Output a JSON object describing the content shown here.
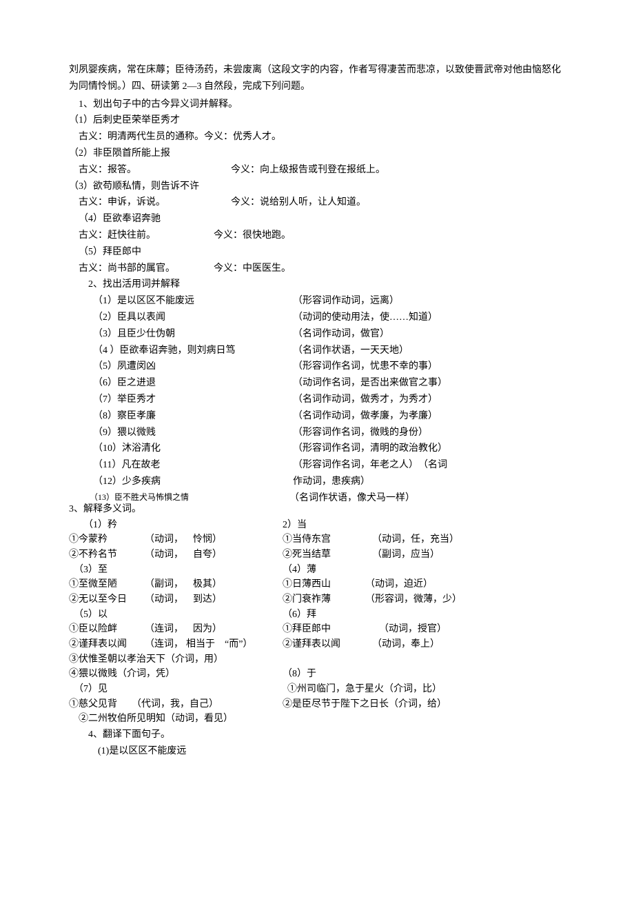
{
  "intro": "刘夙婴疾病，常在床蓐；臣待汤药，未尝废离（这段文字的内容，作者写得凄苦而悲凉，以致使晋武帝对他由恼怒化为同情怜悯。）四、研读第 2—3 自然段，完成下列问题。",
  "sec1": {
    "title": "1、划出句子中的古今异义词并解释。",
    "items": [
      {
        "head": "（1）后刺史臣荣举臣秀才",
        "left": "古义：明清两代生员的通称。今义：优秀人才。",
        "right": ""
      },
      {
        "head": "（2）非臣陨首所能上报",
        "left": "古义：报答。",
        "right": "今义：向上级报告或刊登在报纸上。"
      },
      {
        "head": "（3）欲苟顺私情，则告诉不许",
        "left": "古义：申诉，诉说。",
        "right": "今义：说给别人听，让人知道。"
      },
      {
        "head": "（4）臣欲奉诏奔驰",
        "left": "古义：赶快往前。",
        "right": "今义：很快地跑。"
      },
      {
        "head": "（5）拜臣郎中",
        "left": "古义：尚书部的属官。",
        "right": "今义：中医医生。"
      }
    ]
  },
  "sec2": {
    "title": "2、找出活用词并解释",
    "items": [
      {
        "l": "（1）是以区区不能废远",
        "r": "（形容词作动词，远离）"
      },
      {
        "l": "（2）臣具以表闻",
        "r": "（动词的使动用法，使……知道）"
      },
      {
        "l": "（3）且臣少仕伪朝",
        "r": "（名词作动词，做官）"
      },
      {
        "l": "（4 ）臣欲奉诏奔驰，则刘病日笃",
        "r": "（名词作状语，一天天地）"
      },
      {
        "l": "（5）夙遭闵凶",
        "r": "（形容词作名词，忧患不幸的事）"
      },
      {
        "l": "（6）臣之进退",
        "r": "（动词作名词，是否出来做官之事）"
      },
      {
        "l": "（7）举臣秀才",
        "r": "（名词作动词，做秀才，为秀才）"
      },
      {
        "l": "（8）察臣孝廉",
        "r": "（名词作动词，做孝廉，为孝廉）"
      },
      {
        "l": "（9）猥以微贱",
        "r": "（形容词作名词，微贱的身份）"
      },
      {
        "l": "（10）沐浴清化",
        "r": "（形容词作名词，清明的政治教化）"
      },
      {
        "l": "（11）凡在故老",
        "r": "（形容词作名词，年老之人）　（名词"
      },
      {
        "l": "（12）少多疾病",
        "r": "作动词，患疾病）"
      },
      {
        "l": "（13）臣不胜犬马怖惧之情",
        "r": "（名词作状语，像犬马一样）"
      }
    ]
  },
  "sec3": {
    "title": "3、解释多义词。",
    "c1": {
      "t": "（1）矜",
      "a_l": "①今蒙矜",
      "a_m": "（动词，",
      "a_r": "怜悯）",
      "b_l": "②不矜名节",
      "b_m": "（动词，",
      "b_r": "自夸）"
    },
    "c2": {
      "t": "2）当",
      "a_l": "①当侍东宫",
      "a_m": "（动词，任，充当）",
      "b_l": "②死当结草",
      "b_m": "（副词，应当）"
    },
    "c3": {
      "t": "（3）至",
      "a_l": "①至微至陋",
      "a_m": "（副词，",
      "a_r": "极其）",
      "b_l": "②无以至今日",
      "b_m": "（动词，",
      "b_r": "到达）"
    },
    "c4": {
      "t": "（4）薄",
      "a_l": "①日薄西山",
      "a_m": "（动词，迫近）",
      "b_l": "②门衰祚薄",
      "b_m": "（形容词，微薄，少）"
    },
    "c5": {
      "t": "（5）以",
      "a_l": "①臣以险衅",
      "a_m": "（连词，",
      "a_r": "因为）",
      "b_l": "②谨拜表以闻",
      "b_m": "（连词，",
      "b_r": "相当于　“而”）",
      "c": "③伏惟圣朝以孝治天下（介词，用）",
      "d": "④猥以微贱（介词，凭）"
    },
    "c6": {
      "t": "（6）拜",
      "a_l": "①拜臣郎中",
      "a_m": "（动词，授官）",
      "b_l": "②谨拜表以闻",
      "b_m": "（动词，奉上）"
    },
    "c7": {
      "t": "（7）见",
      "a": "①慈父见背　　（代词，我，自己）",
      "b": "②二州牧伯所见明知（动词，看见）"
    },
    "c8": {
      "t": "（8）于",
      "a": "①州司临门，急于星火（介词，比）",
      "b": "②是臣尽节于陛下之日长（介词，给）"
    }
  },
  "sec4": {
    "title": "4、翻译下面句子。",
    "item1": "(1)是以区区不能废远"
  }
}
